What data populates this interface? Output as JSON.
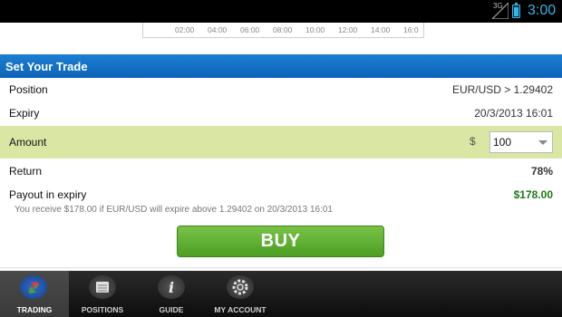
{
  "status_bar": {
    "network": "3G",
    "time": "3:00"
  },
  "chart": {
    "x_ticks": [
      "02:00",
      "04:00",
      "06:00",
      "08:00",
      "10:00",
      "12:00",
      "14:00",
      "16:0"
    ]
  },
  "trade": {
    "title": "Set Your Trade",
    "position_label": "Position",
    "position_value": "EUR/USD > 1.29402",
    "expiry_label": "Expiry",
    "expiry_value": "20/3/2013 16:01",
    "amount_label": "Amount",
    "amount_currency": "$",
    "amount_value": "100",
    "return_label": "Return",
    "return_value": "78%",
    "payout_label": "Payout in expiry",
    "payout_value": "$178.00",
    "note": "You receive $178.00 if EUR/USD will expire above 1.29402 on 20/3/2013 16:01",
    "buy_label": "BUY"
  },
  "nav": {
    "trading": "TRADING",
    "positions": "POSITIONS",
    "guide": "GUIDE",
    "account": "MY ACCOUNT"
  },
  "colors": {
    "header_blue": "#0c63b8",
    "amount_bg": "#dae7a4",
    "buy_green": "#4d9e24",
    "payout_green": "#1e7a16"
  },
  "icons": [
    "signal-icon",
    "battery-icon",
    "trading-icon",
    "positions-icon",
    "guide-info-icon",
    "gear-icon",
    "chevron-down-icon"
  ]
}
